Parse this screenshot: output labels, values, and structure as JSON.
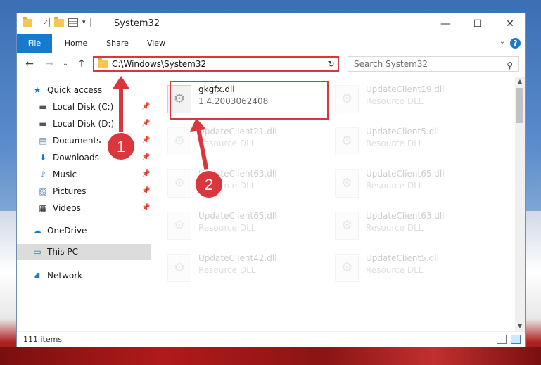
{
  "window": {
    "title": "System32",
    "controls": {
      "minimize": "—",
      "maximize": "☐",
      "close": "✕"
    }
  },
  "ribbon": {
    "tabs": [
      "File",
      "Home",
      "Share",
      "View"
    ],
    "help": "?"
  },
  "navigation": {
    "back": "←",
    "forward": "→",
    "recent": "⌄",
    "up": "↑",
    "address": "C:\\Windows\\System32",
    "search_placeholder": "Search System32"
  },
  "sidebar": {
    "items": [
      {
        "label": "Quick access",
        "icon": "star-icon"
      },
      {
        "label": "Local Disk (C:)",
        "icon": "drive-icon"
      },
      {
        "label": "Local Disk (D:)",
        "icon": "drive-icon"
      },
      {
        "label": "Documents",
        "icon": "documents-icon"
      },
      {
        "label": "Downloads",
        "icon": "download-icon"
      },
      {
        "label": "Music",
        "icon": "music-icon"
      },
      {
        "label": "Pictures",
        "icon": "pictures-icon"
      },
      {
        "label": "Videos",
        "icon": "videos-icon"
      },
      {
        "label": "OneDrive",
        "icon": "cloud-icon"
      },
      {
        "label": "This PC",
        "icon": "computer-icon"
      },
      {
        "label": "Network",
        "icon": "network-icon"
      }
    ]
  },
  "files": [
    {
      "name": "gkgfx.dll",
      "desc": "1.4.2003062408"
    },
    {
      "name": "UpdateClient19.dll",
      "desc": "Resource DLL"
    },
    {
      "name": "UpdateClient21.dll",
      "desc": "Resource DLL"
    },
    {
      "name": "UpdateClient5.dll",
      "desc": "Resource DLL"
    },
    {
      "name": "UpdateClient63.dll",
      "desc": "Resource DLL"
    },
    {
      "name": "UpdateClient65.dll",
      "desc": "Resource DLL"
    },
    {
      "name": "UpdateClient65.dll",
      "desc": "Resource DLL"
    },
    {
      "name": "UpdateClient63.dll",
      "desc": "Resource DLL"
    },
    {
      "name": "UpdateClient42.dll",
      "desc": "Resource DLL"
    },
    {
      "name": "UpdateClient5.dll",
      "desc": "Resource DLL"
    }
  ],
  "status": {
    "item_count": "111 items"
  },
  "annotations": {
    "step1": "1",
    "step2": "2"
  },
  "colors": {
    "accent": "#1979ca",
    "highlight": "#d9363e"
  }
}
